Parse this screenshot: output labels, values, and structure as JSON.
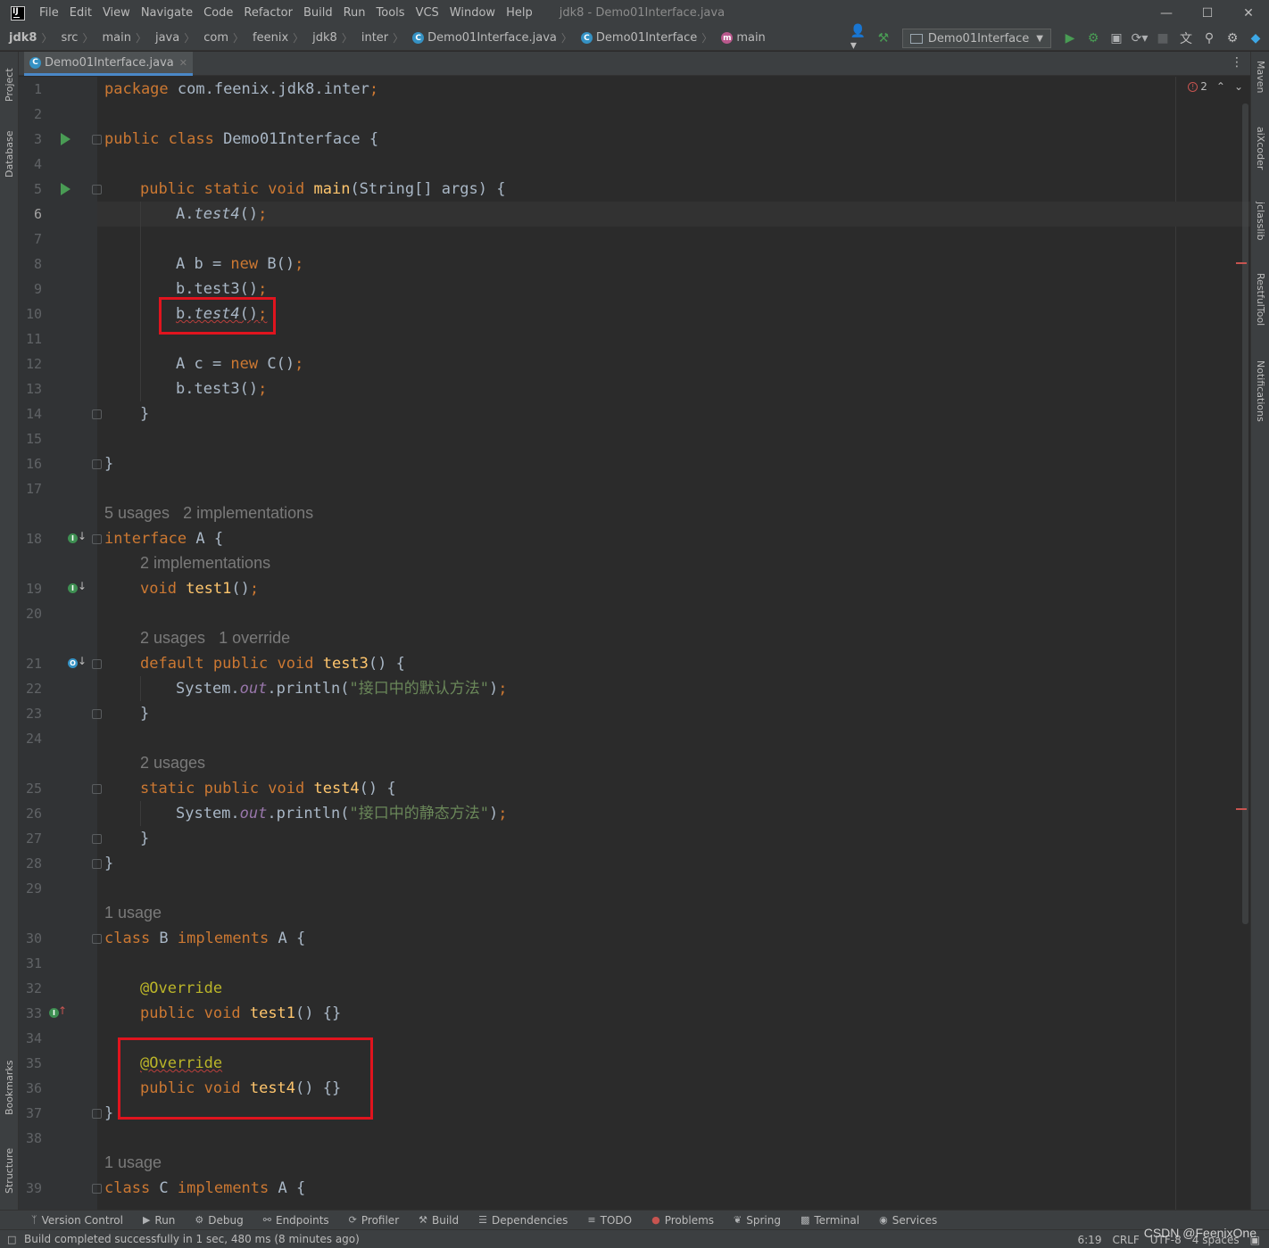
{
  "menubar": {
    "items": [
      "File",
      "Edit",
      "View",
      "Navigate",
      "Code",
      "Refactor",
      "Build",
      "Run",
      "Tools",
      "VCS",
      "Window",
      "Help"
    ],
    "window_title": "jdk8 - Demo01Interface.java"
  },
  "breadcrumbs": [
    "jdk8",
    "src",
    "main",
    "java",
    "com",
    "feenix",
    "jdk8",
    "inter",
    "Demo01Interface.java",
    "Demo01Interface",
    "main"
  ],
  "run_config": "Demo01Interface",
  "editor_tab": "Demo01Interface.java",
  "inspection": {
    "error_count": "2"
  },
  "left_tools": [
    "Project",
    "Database",
    "Bookmarks",
    "Structure"
  ],
  "right_tools": [
    "Maven",
    "aiXcoder",
    "jclasslib",
    "RestfulTool",
    "Notifications"
  ],
  "code": {
    "hints": {
      "a_usages": "5 usages",
      "a_impls": "2 implementations",
      "test1_impls": "2 implementations",
      "test3_usages": "2 usages",
      "test3_override": "1 override",
      "test4_usages": "2 usages",
      "b_usage": "1 usage",
      "c_usage": "1 usage"
    },
    "line_numbers": [
      "1",
      "2",
      "3",
      "4",
      "5",
      "6",
      "7",
      "8",
      "9",
      "10",
      "11",
      "12",
      "13",
      "14",
      "15",
      "16",
      "17",
      "18",
      "19",
      "20",
      "21",
      "22",
      "23",
      "24",
      "25",
      "26",
      "27",
      "28",
      "29",
      "30",
      "31",
      "32",
      "33",
      "34",
      "35",
      "36",
      "37",
      "38",
      "39"
    ],
    "l1": {
      "kw": "package",
      "rest": " com.feenix.jdk8.inter",
      "semi": ";"
    },
    "l3": {
      "kw": "public class",
      "rest": " Demo01Interface {"
    },
    "l5": {
      "kw": "public static void",
      "fn": "main",
      "rest": "(String[] args) {"
    },
    "l6": {
      "obj": "A.",
      "call": "test4",
      "rest": "()",
      "semi": ";"
    },
    "l8": {
      "a": "A b = ",
      "kw": "new",
      "b": " B()",
      "semi": ";"
    },
    "l9": {
      "a": "b.test3()",
      "semi": ";"
    },
    "l10": {
      "obj": "b.",
      "call": "test4",
      "rest": "()",
      "semi": ";"
    },
    "l12": {
      "a": "A c = ",
      "kw": "new",
      "b": " C()",
      "semi": ";"
    },
    "l13": {
      "a": "b.test3()",
      "semi": ";"
    },
    "l14": "}",
    "l16": "}",
    "l18": {
      "kw": "interface",
      "rest": " A {"
    },
    "l19": {
      "kw": "void",
      "fn": "test1",
      "rest": "()",
      "semi": ";"
    },
    "l21": {
      "kw": "default public void",
      "fn": "test3",
      "rest": "() {"
    },
    "l22": {
      "a": "System.",
      "fld": "out",
      "b": ".println(",
      "str": "\"接口中的默认方法\"",
      "c": ")",
      "semi": ";"
    },
    "l23": "}",
    "l25": {
      "kw": "static public void",
      "fn": "test4",
      "rest": "() {"
    },
    "l26": {
      "a": "System.",
      "fld": "out",
      "b": ".println(",
      "str": "\"接口中的静态方法\"",
      "c": ")",
      "semi": ";"
    },
    "l27": "}",
    "l28": "}",
    "l30": {
      "kw": "class",
      "a": " B ",
      "kw2": "implements",
      "b": " A {"
    },
    "l32": "@Override",
    "l33": {
      "kw": "public void",
      "fn": "test1",
      "rest": "() {}"
    },
    "l35": "@Override",
    "l36": {
      "kw": "public void",
      "fn": "test4",
      "rest": "() {}"
    },
    "l37": "}",
    "l39": {
      "kw": "class",
      "a": " C ",
      "kw2": "implements",
      "b": " A {"
    }
  },
  "bottom_tools": [
    "Version Control",
    "Run",
    "Debug",
    "Endpoints",
    "Profiler",
    "Build",
    "Dependencies",
    "TODO",
    "Problems",
    "Spring",
    "Terminal",
    "Services"
  ],
  "status": {
    "message": "Build completed successfully in 1 sec, 480 ms (8 minutes ago)",
    "position": "6:19",
    "line_sep": "CRLF",
    "encoding": "UTF-8",
    "indent": "4 spaces"
  },
  "watermark": "CSDN @FeenixOne",
  "colors": {
    "keyword": "#cc7832",
    "function": "#ffc66d",
    "string": "#6a8759",
    "field": "#9876aa",
    "annotation": "#bbb529",
    "highlight": "#e0141e"
  }
}
